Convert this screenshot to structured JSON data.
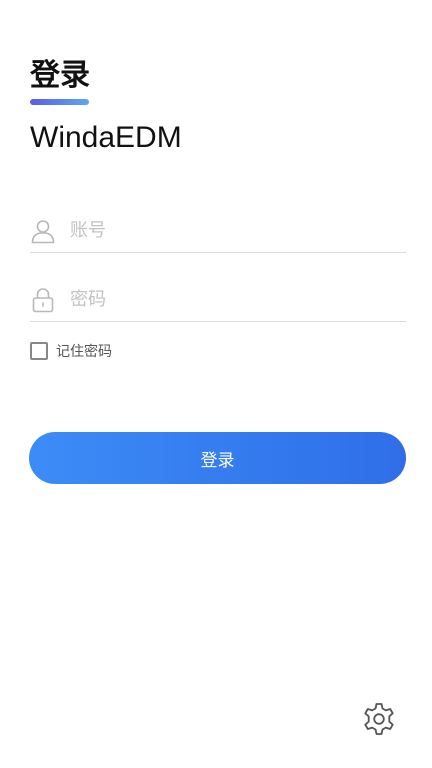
{
  "header": {
    "title": "登录",
    "app_name": "WindaEDM"
  },
  "form": {
    "account_placeholder": "账号",
    "password_placeholder": "密码",
    "remember_label": "记住密码",
    "remember_checked": false,
    "login_label": "登录"
  },
  "icons": {
    "account": "user-icon",
    "password": "lock-icon",
    "settings": "gear-icon"
  },
  "colors": {
    "accent": "#3c8cf7",
    "accent_end": "#2f6ee8",
    "underline_start": "#5b5ce6",
    "underline_end": "#5fa6f0"
  }
}
